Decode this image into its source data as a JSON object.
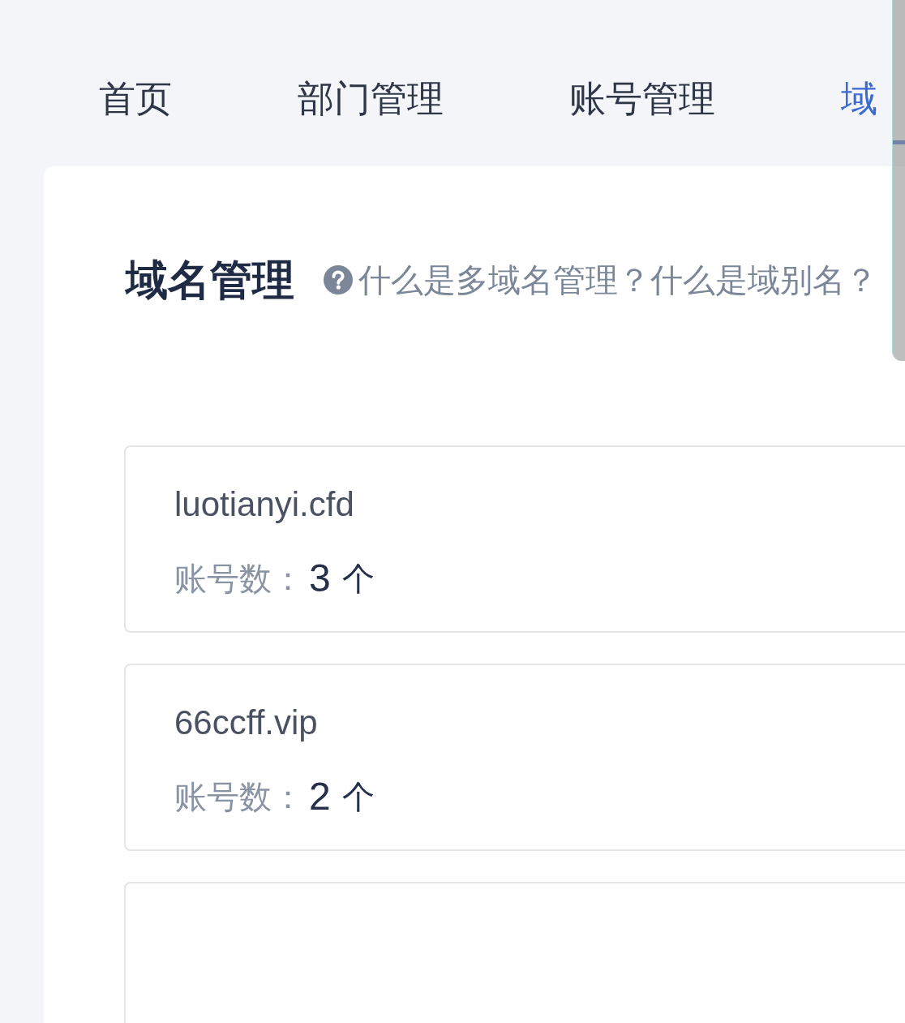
{
  "tabs": [
    {
      "label": "首页",
      "selected": false
    },
    {
      "label": "部门管理",
      "selected": false
    },
    {
      "label": "账号管理",
      "selected": false
    },
    {
      "label": "域",
      "selected": true
    }
  ],
  "panel": {
    "title": "域名管理",
    "help_links": [
      "什么是多域名管理？",
      "什么是域别名？"
    ]
  },
  "domains": [
    {
      "name": "luotianyi.cfd",
      "count_label": "账号数：",
      "count": "3",
      "unit": "个"
    },
    {
      "name": "66ccff.vip",
      "count_label": "账号数：",
      "count": "2",
      "unit": "个"
    }
  ]
}
